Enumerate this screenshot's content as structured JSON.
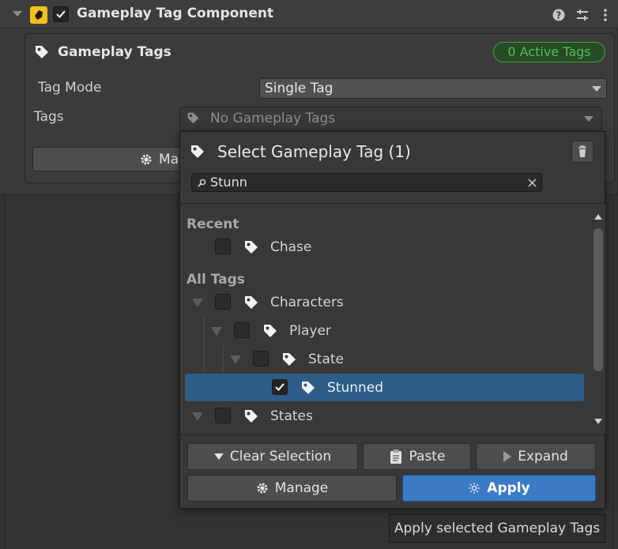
{
  "component": {
    "title": "Gameplay Tag Component",
    "enabled": true
  },
  "card": {
    "title": "Gameplay Tags",
    "active_badge": "0 Active Tags"
  },
  "fields": {
    "tag_mode_label": "Tag Mode",
    "tag_mode_value": "Single Tag",
    "tags_label": "Tags",
    "tags_value": "No Gameplay Tags",
    "manage_button_partial": "Ma"
  },
  "popup": {
    "title": "Select Gameplay Tag (1)",
    "search_value": "Stunn",
    "recent_header": "Recent",
    "recent_items": [
      {
        "label": "Chase",
        "checked": false
      }
    ],
    "all_header": "All Tags",
    "tree": [
      {
        "label": "Characters",
        "checked": false,
        "expanded": true,
        "depth": 0
      },
      {
        "label": "Player",
        "checked": false,
        "expanded": true,
        "depth": 1
      },
      {
        "label": "State",
        "checked": false,
        "expanded": true,
        "depth": 2
      },
      {
        "label": "Stunned",
        "checked": true,
        "selected": true,
        "depth": 3
      },
      {
        "label": "States",
        "checked": false,
        "expanded": true,
        "depth": 0
      }
    ],
    "buttons": {
      "clear_selection": "Clear Selection",
      "paste": "Paste",
      "expand": "Expand",
      "manage": "Manage",
      "apply": "Apply"
    }
  },
  "tooltip": "Apply selected Gameplay Tags",
  "colors": {
    "accent": "#3b7bc6",
    "selection": "#2c5d87",
    "badge_green": "#4ec050",
    "component_icon": "#f2c21a"
  }
}
